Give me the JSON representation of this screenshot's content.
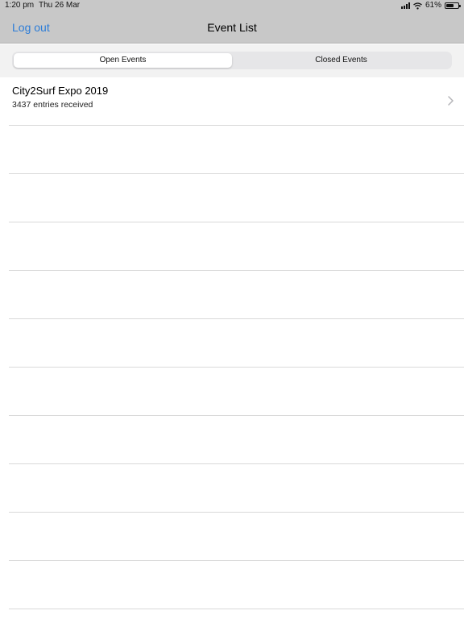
{
  "status": {
    "time": "1:20 pm",
    "date": "Thu 26 Mar",
    "battery_text": "61%",
    "battery_level": 0.61
  },
  "navbar": {
    "left_button": "Log out",
    "title": "Event List"
  },
  "segments": [
    "Open Events",
    "Closed Events"
  ],
  "selected_segment": "Open Events",
  "events": [
    {
      "name": "City2Surf Expo 2019",
      "subtitle": "3437 entries received"
    }
  ],
  "colors": {
    "accent": "#2b7cd8",
    "bar": "#c8c8c8"
  },
  "icons": [
    "signal-icon",
    "wifi-icon",
    "battery-icon",
    "chevron-right-icon"
  ]
}
